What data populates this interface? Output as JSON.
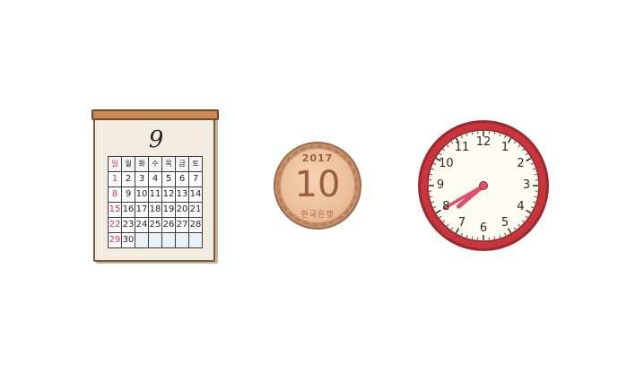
{
  "calendar": {
    "month": "9",
    "weekdays": [
      "일",
      "월",
      "화",
      "수",
      "목",
      "금",
      "토"
    ],
    "weeks": [
      [
        "1",
        "2",
        "3",
        "4",
        "5",
        "6",
        "7"
      ],
      [
        "8",
        "9",
        "10",
        "11",
        "12",
        "13",
        "14"
      ],
      [
        "15",
        "16",
        "17",
        "18",
        "19",
        "20",
        "21"
      ],
      [
        "22",
        "23",
        "24",
        "25",
        "26",
        "27",
        "28"
      ],
      [
        "29",
        "30",
        "",
        "",
        "",
        "",
        ""
      ]
    ],
    "sunday_color": "#d8334a"
  },
  "coin": {
    "year": "2017",
    "value": "10",
    "bank": "한국은행",
    "color": "#c5906c"
  },
  "clock": {
    "numbers": [
      "12",
      "1",
      "2",
      "3",
      "4",
      "5",
      "6",
      "7",
      "8",
      "9",
      "10",
      "11"
    ],
    "time": {
      "hour": 7,
      "minute": 40
    },
    "rim_color": "#c9343d",
    "hand_color": "#e0506a",
    "face_color": "#fffdf2"
  }
}
